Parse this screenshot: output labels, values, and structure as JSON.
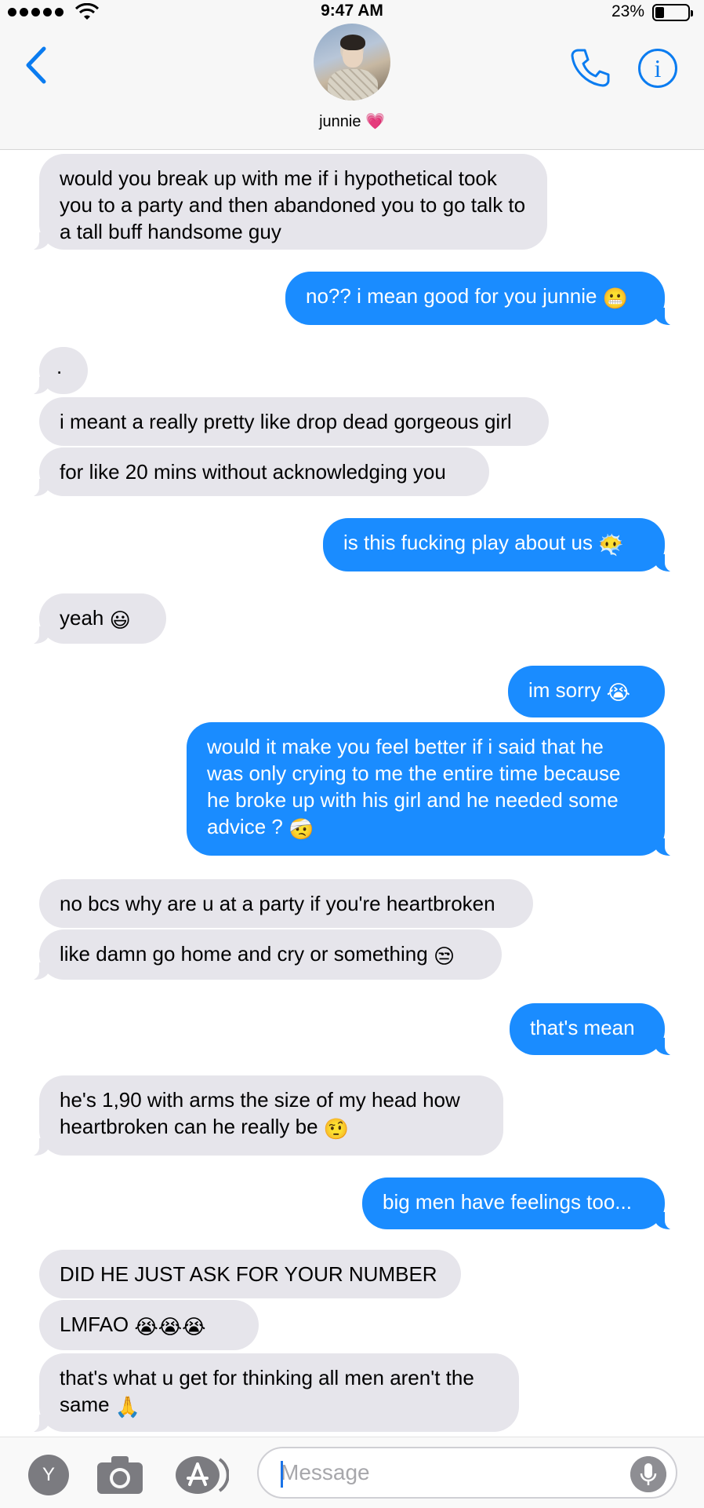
{
  "status_bar": {
    "time": "9:47 AM",
    "battery": "23%"
  },
  "header": {
    "contact_name": "junnie",
    "heart": "💗"
  },
  "messages": [
    {
      "text": "would you break up with me if i hypothetical took you to a party and then abandoned you to go talk to a tall buff handsome guy",
      "emoji": ""
    },
    {
      "text": "no?? i mean good for you junnie",
      "emoji": "😬"
    },
    {
      "text": ".",
      "emoji": ""
    },
    {
      "text": "i meant a really pretty like drop dead gorgeous girl",
      "emoji": ""
    },
    {
      "text": "for like 20 mins without acknowledging you",
      "emoji": ""
    },
    {
      "text": "is this fucking play about us",
      "emoji": "😶‍🌫️"
    },
    {
      "text": "yeah",
      "emoji": "😃"
    },
    {
      "text": "im sorry",
      "emoji": "😭"
    },
    {
      "text": "would it make you feel better if i said that he was only crying to me the entire time because he broke up with his girl and he needed some advice ?",
      "emoji": "🤕"
    },
    {
      "text": "no bcs why are u at a party if you're heartbroken",
      "emoji": ""
    },
    {
      "text": "like damn go home and cry or something",
      "emoji": "😒"
    },
    {
      "text": "that's mean",
      "emoji": ""
    },
    {
      "text": "he's 1,90 with arms the size of my head how heartbroken can he really be",
      "emoji": "🤨"
    },
    {
      "text": "big men have feelings too...",
      "emoji": ""
    },
    {
      "text": "DID HE JUST ASK FOR YOUR NUMBER",
      "emoji": ""
    },
    {
      "text": "LMFAO",
      "emoji": "😭😭😭"
    },
    {
      "text": "that's what u get for thinking all men aren't the same",
      "emoji": "🙏"
    }
  ],
  "input_bar": {
    "app_letter": "Y",
    "placeholder": "Message"
  },
  "colors": {
    "outgoing": "#1a8cff",
    "incoming": "#e6e5eb",
    "accent": "#0b7cf0"
  }
}
